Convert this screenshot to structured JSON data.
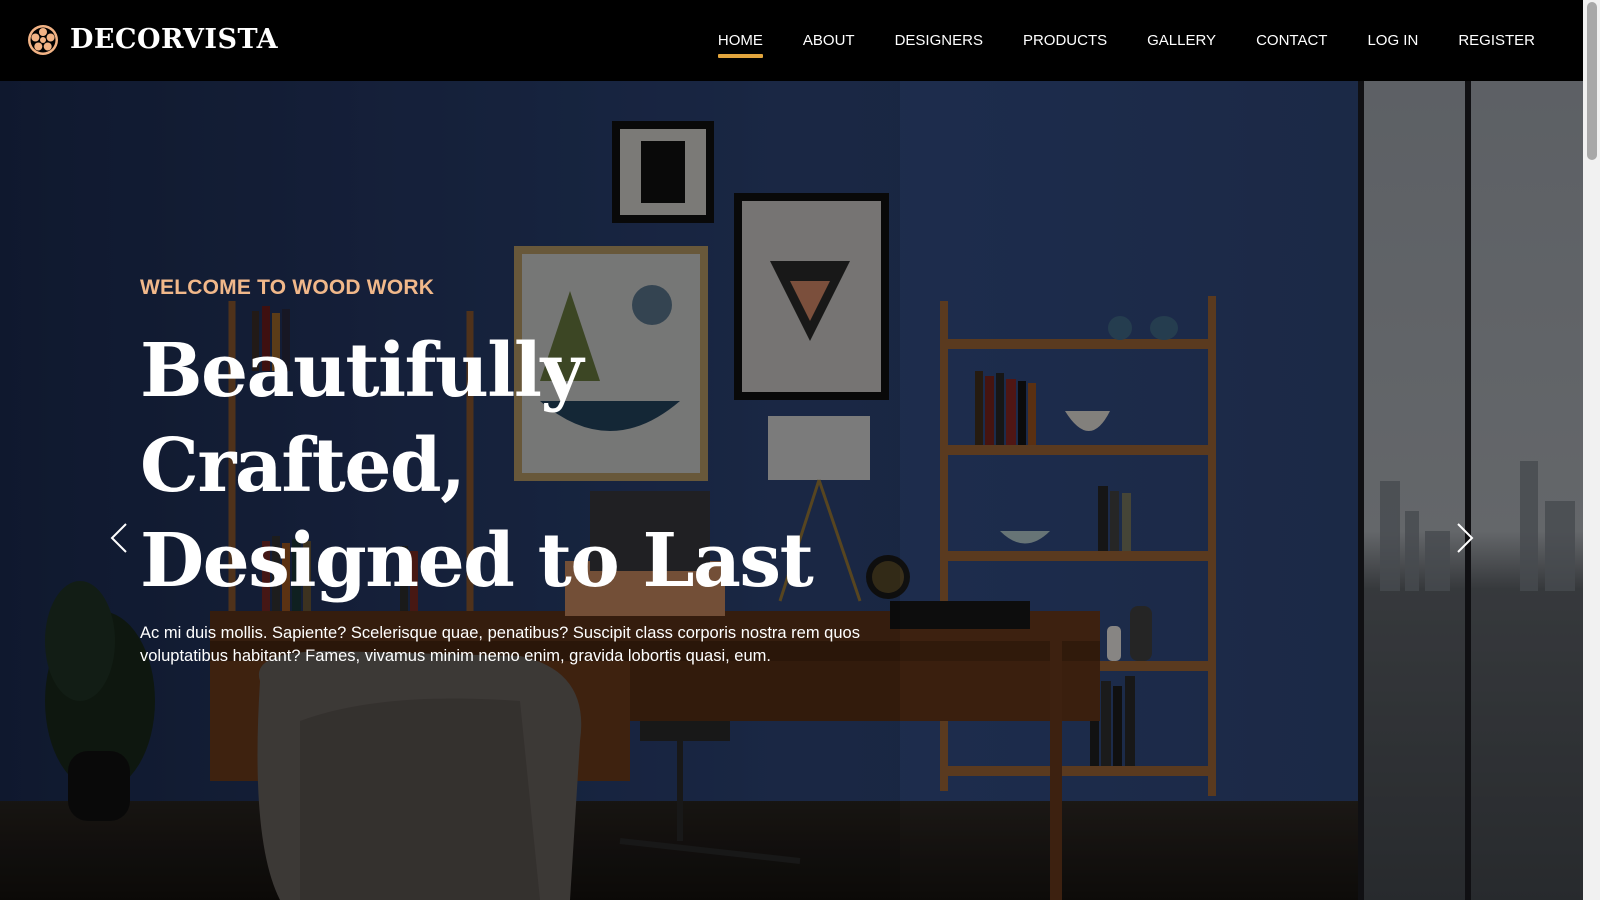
{
  "brand": {
    "name": "DECORVISTA",
    "logo_icon": "gear-icon",
    "accent_color": "#e2a53d"
  },
  "nav": {
    "items": [
      {
        "label": "HOME",
        "active": true
      },
      {
        "label": "ABOUT",
        "active": false
      },
      {
        "label": "DESIGNERS",
        "active": false
      },
      {
        "label": "PRODUCTS",
        "active": false
      },
      {
        "label": "GALLERY",
        "active": false
      },
      {
        "label": "CONTACT",
        "active": false
      },
      {
        "label": "LOG IN",
        "active": false
      },
      {
        "label": "REGISTER",
        "active": false
      }
    ]
  },
  "hero": {
    "eyebrow": "WELCOME TO WOOD WORK",
    "title_line1": "Beautifully Crafted,",
    "title_line2": "Designed to Last",
    "text_line1": "Ac mi duis mollis. Sapiente? Scelerisque quae, penatibus? Suscipit class corporis nostra rem quos",
    "text_line2": "voluptatibus habitant? Fames, vivamus minim nemo enim, gravida lobortis quasi, eum.",
    "eyebrow_color": "#f1b88a",
    "prev_icon": "chevron-left-icon",
    "next_icon": "chevron-right-icon"
  }
}
